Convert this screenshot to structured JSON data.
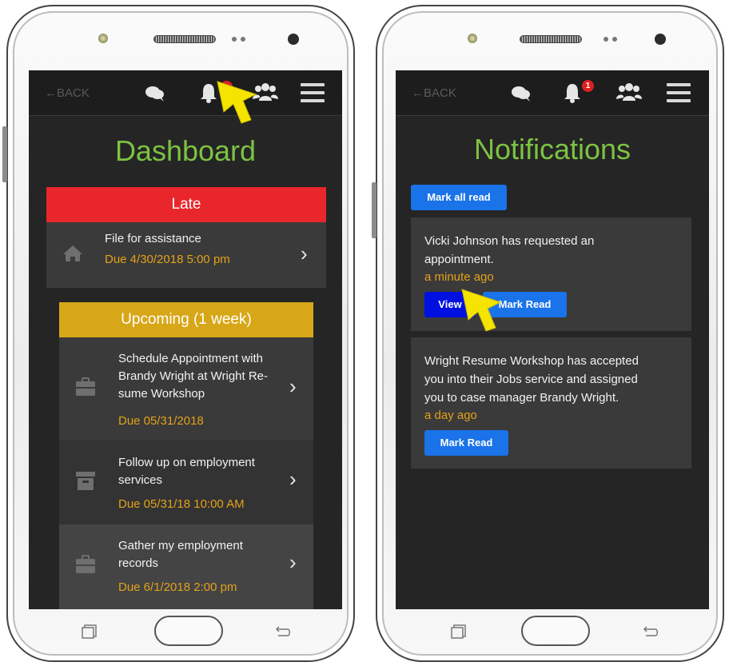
{
  "left_screen": {
    "back_label": "BACK",
    "title": "Dashboard",
    "late": {
      "header": "Late",
      "item": {
        "title": "File for assistance",
        "due": "Due 4/30/2018 5:00 pm",
        "icon": "home-icon"
      }
    },
    "upcoming": {
      "header": "Upcoming (1 week)",
      "items": [
        {
          "title_lines": [
            "Schedule Appointment with",
            "Brandy Wright at Wright Re-",
            "sume Workshop"
          ],
          "due": "Due 05/31/2018",
          "icon": "briefcase-icon"
        },
        {
          "title_lines": [
            "Follow up on employment",
            "services"
          ],
          "due": "Due 05/31/18 10:00 AM",
          "icon": "archive-icon"
        },
        {
          "title_lines": [
            "Gather my employment",
            "records"
          ],
          "due": "Due 6/1/2018 2:00 pm",
          "icon": "briefcase-icon"
        }
      ]
    }
  },
  "right_screen": {
    "back_label": "BACK",
    "title": "Notifications",
    "badge_count": "1",
    "mark_all_label": "Mark all read",
    "notifications": [
      {
        "text_lines": [
          "Vicki Johnson has requested an",
          "appointment."
        ],
        "time": "a minute ago",
        "view_label": "View",
        "mark_label": "Mark Read"
      },
      {
        "text_lines": [
          "Wright Resume Workshop has accepted",
          "you into their Jobs service and assigned",
          "you to case manager Brandy Wright."
        ],
        "time": "a day ago",
        "mark_label": "Mark Read"
      }
    ]
  },
  "colors": {
    "accent_green": "#7dc242",
    "late_red": "#e8262b",
    "upcoming_gold": "#d7a718",
    "due_orange": "#e3a21a",
    "button_blue": "#1a73e8",
    "pointer_yellow": "#f4e400"
  }
}
